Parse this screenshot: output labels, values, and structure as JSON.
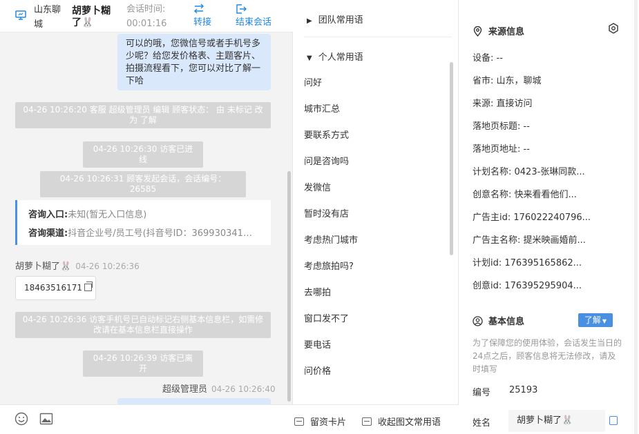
{
  "header": {
    "location": "山东聊城",
    "customer_name": "胡萝卜糊了🐰",
    "session_time_label": "会话时间:",
    "session_time_value": "00:01:16",
    "transfer_label": "转接",
    "end_label": "结束会话"
  },
  "chat": {
    "messages": [
      {
        "type": "agent",
        "text": "可以的哦，您微信号或者手机号多少呢？给您发价格表、主题客片、拍摄流程看下，您可以对比了解一下哈"
      },
      {
        "type": "system",
        "text": "04-26 10:26:20 客服 超级管理员 编辑 顾客状态： 由 未标记 改为 了解"
      },
      {
        "type": "system",
        "text": "04-26 10:26:30 访客已进线"
      },
      {
        "type": "system",
        "text": "04-26 10:26:31 顾客发起会话，会话编号：26585"
      },
      {
        "type": "system",
        "text": "04-26 10:26:36 访客手机号已自动标记右侧基本信息栏，如需修改请在基本信息栏直接操作"
      },
      {
        "type": "system",
        "text": "04-26 10:26:39 访客已离开"
      }
    ],
    "entry_label": "咨询入口:",
    "entry_value": "未知(暂无入口信息)",
    "channel_label": "咨询渠道:",
    "channel_value": "抖音企业号/员工号(抖音号ID：369930341…",
    "visitor_sender": "胡萝卜糊了🐰",
    "visitor_time": "04-26 10:26:36",
    "phone_number": "18463516171",
    "agent_sender": "超级管理员",
    "agent_time": "04-26 10:26:40"
  },
  "phrases": {
    "team_group": "团队常用语",
    "personal_group": "个人常用语",
    "items": [
      "问好",
      "城市汇总",
      "要联系方式",
      "问是咨询吗",
      "发微信",
      "暂时没有店",
      "考虑热门城市",
      "考虑旅拍吗?",
      "去哪拍",
      "窗口发不了",
      "要电话",
      "问价格"
    ],
    "footer_card": "留资卡片",
    "footer_collapse": "收起图文常用语"
  },
  "source_info": {
    "title": "来源信息",
    "device": "设备: --",
    "province_city": "省市: 山东，聊城",
    "source": "来源: 直接访问",
    "landing_title": "落地页标题: --",
    "landing_url": "落地页地址: --",
    "plan_name": "计划名称: 0423-张琳同款...",
    "creative_name": "创意名称: 快来看看他们...",
    "advertiser_id": "广告主id: 176022240796...",
    "advertiser_name": "广告主名称: 提米映画婚前...",
    "plan_id": "计划id: 176395165862...",
    "creative_id": "创意id: 176395295904..."
  },
  "basic_info": {
    "title": "基本信息",
    "status_tag": "了解",
    "note": "为了保障您的使用体验，会话发生当日的24点之后，顾客信息将无法修改，请及时填写",
    "number_label": "编号",
    "number_value": "25193",
    "name_label": "姓名",
    "name_value": "胡萝卜糊了🐰"
  },
  "colors": {
    "accent": "#1e88e5",
    "tag": "#4a90e2",
    "agent_bubble": "#d9e8fb",
    "system_bubble": "#d6d6d6"
  }
}
